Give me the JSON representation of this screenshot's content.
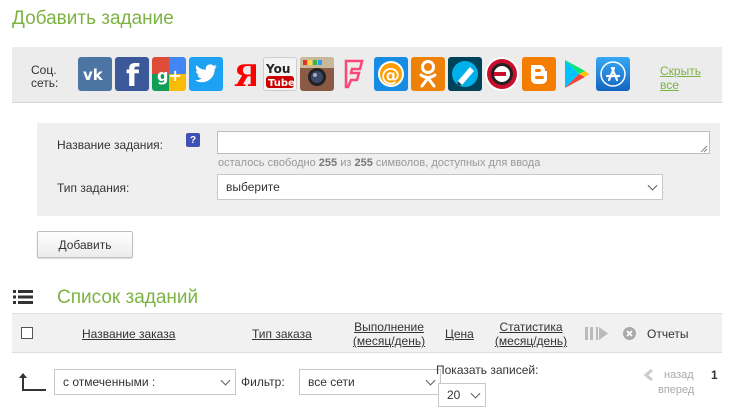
{
  "page": {
    "title": "Добавить задание"
  },
  "social": {
    "label": "Соц. сеть:",
    "hide_label": "Скрыть все",
    "icons": [
      {
        "name": "vkontakte",
        "glyph": "vk",
        "color": "#4c75a3"
      },
      {
        "name": "facebook",
        "glyph": "f",
        "color": "#3b5998"
      },
      {
        "name": "google-plus",
        "glyph": "g+",
        "color": "#dd4b39"
      },
      {
        "name": "twitter",
        "glyph": "t",
        "color": "#1da1f2"
      },
      {
        "name": "yandex",
        "glyph": "Я",
        "color": "#ff0000"
      },
      {
        "name": "youtube",
        "glyph": "You Tube",
        "color": "#cc0000"
      },
      {
        "name": "instagram",
        "glyph": "cam",
        "color": "#8a5a44"
      },
      {
        "name": "foursquare",
        "glyph": "F",
        "color": "#f94877"
      },
      {
        "name": "mail-ru",
        "glyph": "@",
        "color": "#168de2"
      },
      {
        "name": "odnoklassniki",
        "glyph": "ok",
        "color": "#ee8208"
      },
      {
        "name": "livejournal",
        "glyph": "lj",
        "color": "#004359"
      },
      {
        "name": "ask-fm",
        "glyph": "e",
        "color": "#c8102e"
      },
      {
        "name": "blogger",
        "glyph": "B",
        "color": "#f57d00"
      },
      {
        "name": "google-play",
        "glyph": "play",
        "color": "#ffffff"
      },
      {
        "name": "app-store",
        "glyph": "A",
        "color": "#1e88e5"
      }
    ]
  },
  "form": {
    "name_label": "Название задания:",
    "help_glyph": "?",
    "name_value": "",
    "chars_prefix": "осталось свободно",
    "chars_left": "255",
    "chars_mid": "из",
    "chars_total": "255",
    "chars_suffix": "символов, доступных для ввода",
    "type_label": "Тип задания:",
    "type_value": "выберите",
    "add_button": "Добавить"
  },
  "list": {
    "title": "Список заданий",
    "columns": {
      "name": "Название заказа",
      "type": "Тип заказа",
      "done": "Выполнение (месяц/день)",
      "price": "Цена",
      "stats": "Статистика (месяц/день)"
    },
    "reports_label": "Отчеты"
  },
  "bottom": {
    "bulk_value": "с отмеченными :",
    "filter_label": "Фильтр:",
    "filter_value": "все сети",
    "show_label": "Показать записей:",
    "show_value": "20",
    "prev_label": "назад",
    "next_label": "вперед",
    "page_number": "1"
  }
}
